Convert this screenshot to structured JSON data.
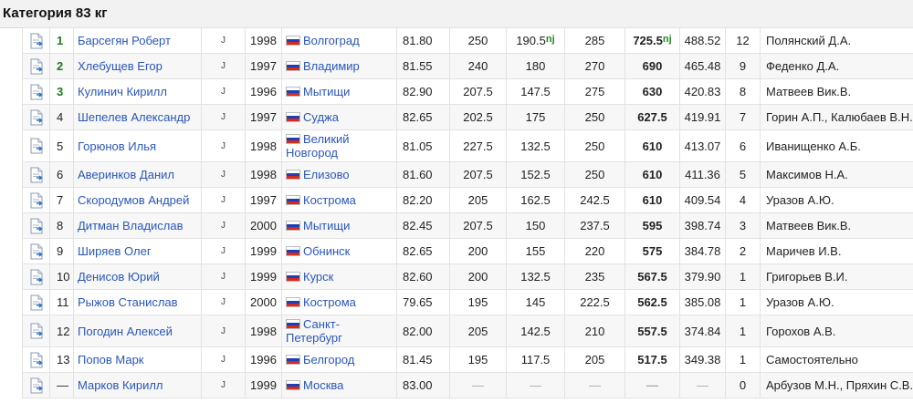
{
  "category_title": "Категория 83 кг",
  "rows": [
    {
      "rank": "1",
      "name": "Барсегян Роберт",
      "j": "J",
      "year": "1998",
      "city": "Волгоград",
      "bw": "81.80",
      "squat": "250",
      "bench": "190.5",
      "bench_record": "nj",
      "deadlift": "285",
      "total": "725.5",
      "total_record": "nj",
      "points": "488.52",
      "score": "12",
      "coach": "Полянский Д.А."
    },
    {
      "rank": "2",
      "name": "Хлебущев Егор",
      "j": "J",
      "year": "1997",
      "city": "Владимир",
      "bw": "81.55",
      "squat": "240",
      "bench": "180",
      "deadlift": "270",
      "total": "690",
      "points": "465.48",
      "score": "9",
      "coach": "Феденко Д.А."
    },
    {
      "rank": "3",
      "name": "Кулинич Кирилл",
      "j": "J",
      "year": "1996",
      "city": "Мытищи",
      "bw": "82.90",
      "squat": "207.5",
      "bench": "147.5",
      "deadlift": "275",
      "total": "630",
      "points": "420.83",
      "score": "8",
      "coach": "Матвеев Вик.В."
    },
    {
      "rank": "4",
      "name": "Шепелев Александр",
      "j": "J",
      "year": "1997",
      "city": "Суджа",
      "bw": "82.65",
      "squat": "202.5",
      "bench": "175",
      "deadlift": "250",
      "total": "627.5",
      "points": "419.91",
      "score": "7",
      "coach": "Горин А.П., Калюбаев В.Н."
    },
    {
      "rank": "5",
      "name": "Горюнов Илья",
      "j": "J",
      "year": "1998",
      "city": "Великий Новгород",
      "bw": "81.05",
      "squat": "227.5",
      "bench": "132.5",
      "deadlift": "250",
      "total": "610",
      "points": "413.07",
      "score": "6",
      "coach": "Иванищенко А.Б."
    },
    {
      "rank": "6",
      "name": "Аверинков Данил",
      "j": "J",
      "year": "1998",
      "city": "Елизово",
      "bw": "81.60",
      "squat": "207.5",
      "bench": "152.5",
      "deadlift": "250",
      "total": "610",
      "points": "411.36",
      "score": "5",
      "coach": "Максимов Н.А."
    },
    {
      "rank": "7",
      "name": "Скородумов Андрей",
      "j": "J",
      "year": "1997",
      "city": "Кострома",
      "bw": "82.20",
      "squat": "205",
      "bench": "162.5",
      "deadlift": "242.5",
      "total": "610",
      "points": "409.54",
      "score": "4",
      "coach": "Уразов А.Ю."
    },
    {
      "rank": "8",
      "name": "Дитман Владислав",
      "j": "J",
      "year": "2000",
      "city": "Мытищи",
      "bw": "82.45",
      "squat": "207.5",
      "bench": "150",
      "deadlift": "237.5",
      "total": "595",
      "points": "398.74",
      "score": "3",
      "coach": "Матвеев Вик.В."
    },
    {
      "rank": "9",
      "name": "Ширяев Олег",
      "j": "J",
      "year": "1999",
      "city": "Обнинск",
      "bw": "82.65",
      "squat": "200",
      "bench": "155",
      "deadlift": "220",
      "total": "575",
      "points": "384.78",
      "score": "2",
      "coach": "Маричев И.В."
    },
    {
      "rank": "10",
      "name": "Денисов Юрий",
      "j": "J",
      "year": "1999",
      "city": "Курск",
      "bw": "82.60",
      "squat": "200",
      "bench": "132.5",
      "deadlift": "235",
      "total": "567.5",
      "points": "379.90",
      "score": "1",
      "coach": "Григорьев В.И."
    },
    {
      "rank": "11",
      "name": "Рыжов Станислав",
      "j": "J",
      "year": "2000",
      "city": "Кострома",
      "bw": "79.65",
      "squat": "195",
      "bench": "145",
      "deadlift": "222.5",
      "total": "562.5",
      "points": "385.08",
      "score": "1",
      "coach": "Уразов А.Ю."
    },
    {
      "rank": "12",
      "name": "Погодин Алексей",
      "j": "J",
      "year": "1998",
      "city": "Санкт-Петербург",
      "bw": "82.00",
      "squat": "205",
      "bench": "142.5",
      "deadlift": "210",
      "total": "557.5",
      "points": "374.84",
      "score": "1",
      "coach": "Горохов А.В."
    },
    {
      "rank": "13",
      "name": "Попов Марк",
      "j": "J",
      "year": "1996",
      "city": "Белгород",
      "bw": "81.45",
      "squat": "195",
      "bench": "117.5",
      "deadlift": "205",
      "total": "517.5",
      "points": "349.38",
      "score": "1",
      "coach": "Самостоятельно"
    },
    {
      "rank": "—",
      "name": "Марков Кирилл",
      "j": "J",
      "year": "1999",
      "city": "Москва",
      "bw": "83.00",
      "squat": "—",
      "bench": "—",
      "deadlift": "—",
      "total": "—",
      "points": "—",
      "score": "0",
      "coach": "Арбузов М.Н., Пряхин С.В."
    }
  ]
}
